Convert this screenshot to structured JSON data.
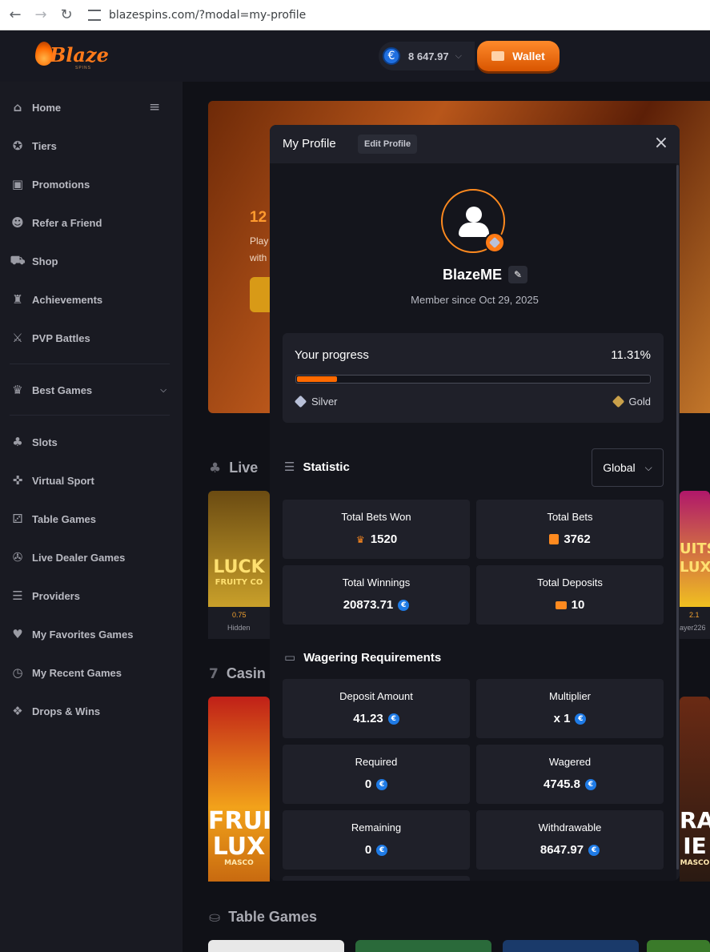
{
  "browser": {
    "url": "blazespins.com/?modal=my-profile",
    "back": "←",
    "forward": "→",
    "reload": "↻"
  },
  "header": {
    "logo_text": "Blaze",
    "logo_sub": "SPINS",
    "balance": "8 647.97",
    "currency_symbol": "€",
    "wallet_label": "Wallet"
  },
  "sidebar": {
    "items": [
      {
        "label": "Home",
        "icon": "home-icon"
      },
      {
        "label": "Tiers",
        "icon": "medal-icon"
      },
      {
        "label": "Promotions",
        "icon": "gift-icon"
      },
      {
        "label": "Refer a Friend",
        "icon": "users-icon"
      },
      {
        "label": "Shop",
        "icon": "cart-icon"
      },
      {
        "label": "Achievements",
        "icon": "trophy-icon"
      },
      {
        "label": "PVP Battles",
        "icon": "swords-icon"
      },
      {
        "label": "Best Games",
        "icon": "crown-icon"
      },
      {
        "label": "Slots",
        "icon": "cherry-icon"
      },
      {
        "label": "Virtual Sport",
        "icon": "gamepad-icon"
      },
      {
        "label": "Table Games",
        "icon": "dice-icon"
      },
      {
        "label": "Live Dealer Games",
        "icon": "chip-icon"
      },
      {
        "label": "Providers",
        "icon": "stack-icon"
      },
      {
        "label": "My Favorites Games",
        "icon": "heart-icon"
      },
      {
        "label": "My Recent Games",
        "icon": "clock-icon"
      },
      {
        "label": "Drops & Wins",
        "icon": "drops-icon"
      }
    ]
  },
  "background": {
    "hero_title": "12",
    "hero_text_1": "Play",
    "hero_text_2": "with",
    "section_live": "Live",
    "section_casino": "Casin",
    "section_table": "Table Games",
    "tile1_label": "LUCK",
    "tile1_sub": "FRUITY CO",
    "tile1_val": "0.75",
    "tile1_user": "Hidden",
    "tile2_label": "UITS",
    "tile2_sub": "LUXO",
    "tile2_val": "2.1",
    "tile2_user": "ayer226",
    "tile3_label": "FRUI",
    "tile3_sub": "LUX",
    "tile3_brand": "MASCO",
    "tile4_label": "RA",
    "tile4_sub": "IE",
    "tile4_brand": "MASCO"
  },
  "modal": {
    "title": "My Profile",
    "edit_label": "Edit Profile",
    "close_glyph": "×",
    "username": "BlazeME",
    "member_since": "Member since Oct 29, 2025",
    "progress": {
      "label": "Your progress",
      "value_text": "11.31%",
      "fraction": 0.1131,
      "from_tier": "Silver",
      "to_tier": "Gold"
    },
    "statistic": {
      "title": "Statistic",
      "filter": "Global",
      "cards": [
        {
          "label": "Total Bets Won",
          "value": "1520",
          "icon": "trophy-icon"
        },
        {
          "label": "Total Bets",
          "value": "3762",
          "icon": "ticket-icon"
        },
        {
          "label": "Total Winnings",
          "value": "20873.71",
          "icon": "euro-icon"
        },
        {
          "label": "Total Deposits",
          "value": "10",
          "icon": "wallet-icon"
        }
      ]
    },
    "wagering": {
      "title": "Wagering Requirements",
      "cards": [
        {
          "label": "Deposit Amount",
          "value": "41.23"
        },
        {
          "label": "Multiplier",
          "value": "x 1"
        },
        {
          "label": "Required",
          "value": "0"
        },
        {
          "label": "Wagered",
          "value": "4745.8"
        },
        {
          "label": "Remaining",
          "value": "0"
        },
        {
          "label": "Withdrawable",
          "value": "8647.97"
        }
      ]
    }
  },
  "colors": {
    "accent": "#ff7a14",
    "euro": "#1f7be6",
    "card": "#1f2029",
    "bg": "#14151c"
  }
}
